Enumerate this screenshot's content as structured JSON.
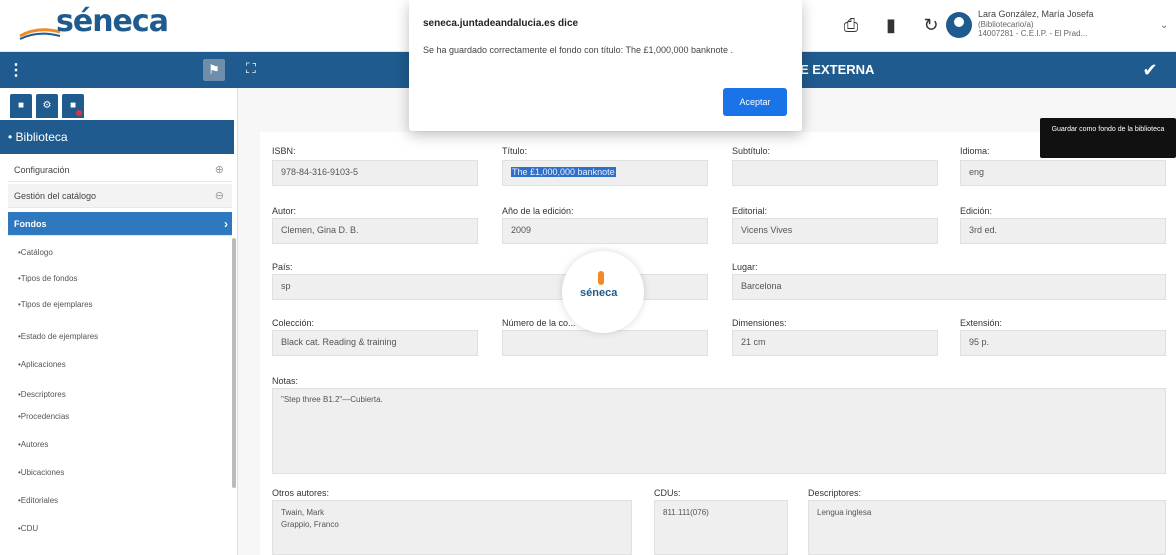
{
  "header": {
    "logo": "séneca",
    "user_name": "Lara González, María Josefa",
    "user_role": "(Bibliotecario/a)",
    "user_center": "14007281 - C.E.I.P. - El Prad..."
  },
  "navbar": {
    "title": "E EXTERNA"
  },
  "sidebar": {
    "section_title": "• Biblioteca",
    "config": "Configuración",
    "catalog_group": "Gestión del catálogo",
    "active_item": "Fondos",
    "items": [
      "•Catálogo",
      "•Tipos de fondos",
      "•Tipos de ejemplares",
      "•Estado de ejemplares",
      "•Aplicaciones",
      "•Descriptores",
      "•Procedencias",
      "•Autores",
      "•Ubicaciones",
      "•Editoriales",
      "•CDU"
    ]
  },
  "form": {
    "isbn_label": "ISBN:",
    "isbn": "978-84-316-9103-5",
    "titulo_label": "Título:",
    "titulo": "The £1,000,000 banknote",
    "subtitulo_label": "Subtítulo:",
    "subtitulo": "",
    "idioma_label": "Idioma:",
    "idioma": "eng",
    "autor_label": "Autor:",
    "autor": "Clemen, Gina D. B.",
    "anio_label": "Año de la edición:",
    "anio": "2009",
    "editorial_label": "Editorial:",
    "editorial": "Vicens Vives",
    "edicion_label": "Edición:",
    "edicion": "3rd ed.",
    "pais_label": "País:",
    "pais": "sp",
    "lugar_label": "Lugar:",
    "lugar": "Barcelona",
    "coleccion_label": "Colección:",
    "coleccion": "Black cat. Reading & training",
    "numero_label": "Número de la co...",
    "numero": "",
    "dimensiones_label": "Dimensiones:",
    "dimensiones": "21 cm",
    "extension_label": "Extensión:",
    "extension": "95 p.",
    "notas_label": "Notas:",
    "notas": "\"Step three B1.2\"—Cubierta.",
    "otros_label": "Otros autores:",
    "otros_1": "Twain, Mark",
    "otros_2": "Grappio, Franco",
    "cdus_label": "CDUs:",
    "cdus": "811.111(076)",
    "descriptores_label": "Descriptores:",
    "descriptores": "Lengua inglesa"
  },
  "spinner_text": "séneca",
  "tooltip": "Guardar como fondo de la biblioteca",
  "dialog": {
    "title": "seneca.juntadeandalucia.es dice",
    "message": "Se ha guardado correctamente el fondo con título: The £1,000,000 banknote .",
    "ok_label": "Aceptar"
  },
  "colors": {
    "brand": "#1f5b8e",
    "active_menu": "#2e78bf",
    "button": "#1a73e8"
  }
}
